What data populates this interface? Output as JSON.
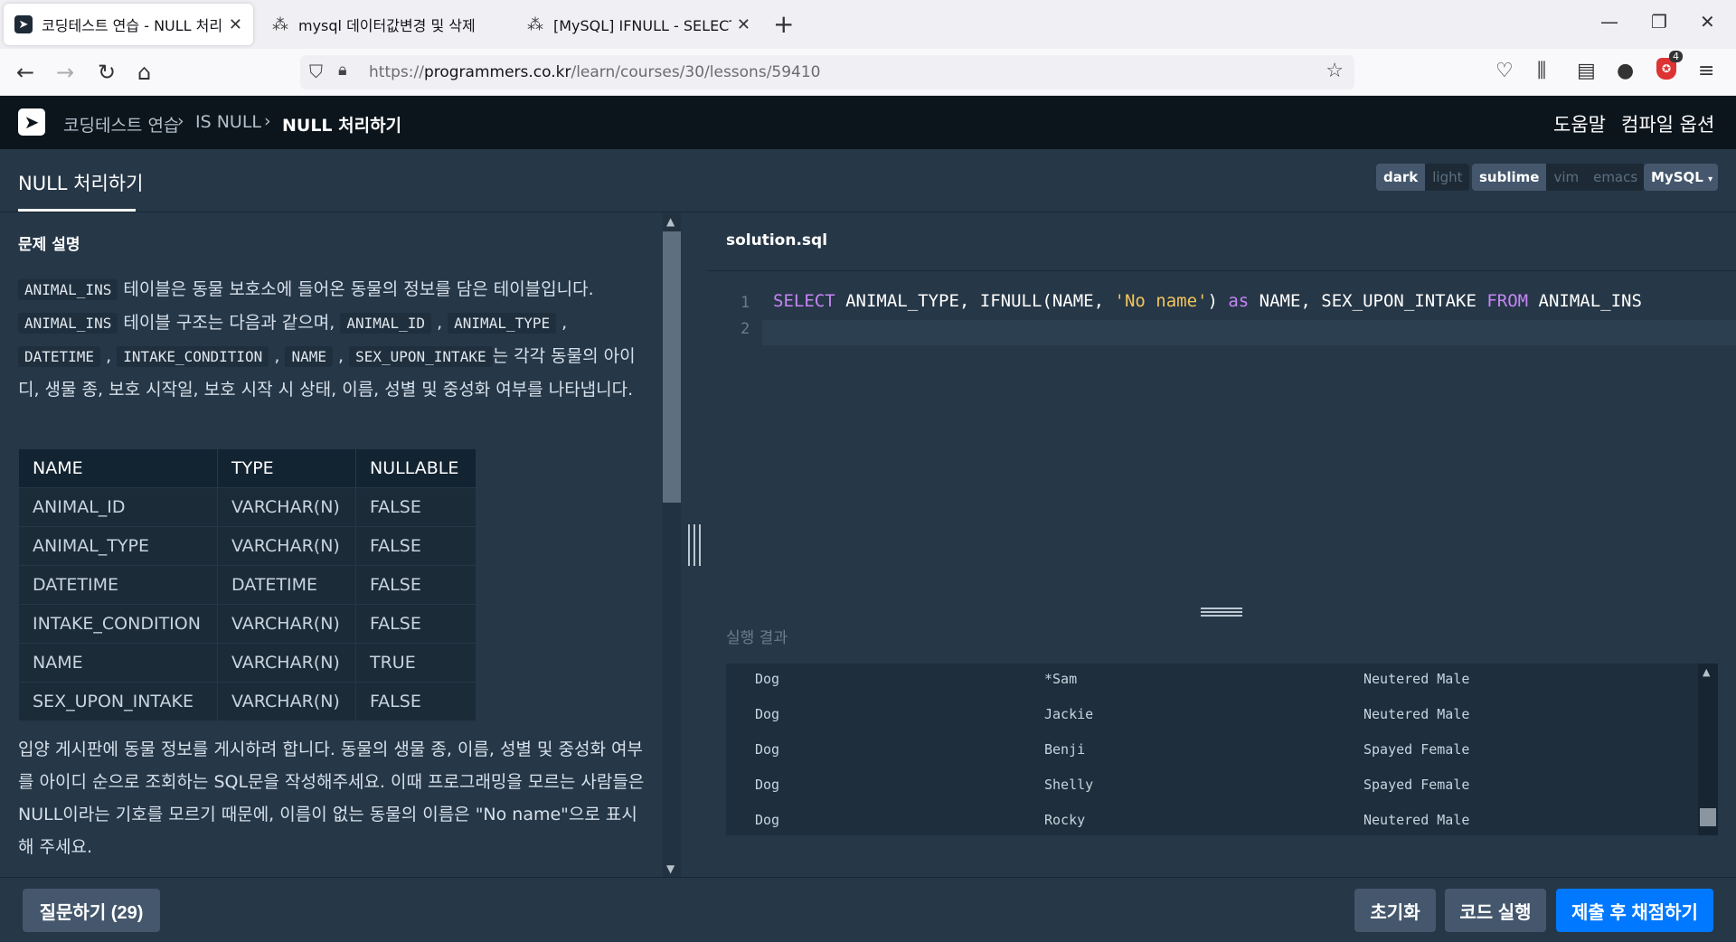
{
  "browser": {
    "tabs": [
      {
        "title": "코딩테스트 연습 - NULL 처리하",
        "active": true
      },
      {
        "title": "mysql 데이터값변경 및 삭제",
        "active": false
      },
      {
        "title": "[MySQL] IFNULL - SELECT 문에",
        "active": false
      }
    ],
    "url_prefix": "https://",
    "url_domain": "programmers.co.kr",
    "url_path": "/learn/courses/30/lessons/59410",
    "extension_badge": "4"
  },
  "header": {
    "breadcrumb": [
      "코딩테스트 연습",
      "IS NULL",
      "NULL 처리하기"
    ],
    "help": "도움말",
    "compile_options": "컴파일 옵션"
  },
  "subheader": {
    "lesson_title": "NULL 처리하기",
    "themes": [
      "dark",
      "light"
    ],
    "keymaps": [
      "sublime",
      "vim",
      "emacs"
    ],
    "language": "MySQL"
  },
  "problem": {
    "section_title": "문제 설명",
    "intro": {
      "table_name": "ANIMAL_INS",
      "text1": " 테이블은 동물 보호소에 들어온 동물의 정보를 담은 테이블입니다. ",
      "text2": " 테이블 구조는 다음과 같으며, ",
      "cols": [
        "ANIMAL_ID",
        "ANIMAL_TYPE",
        "DATETIME",
        "INTAKE_CONDITION",
        "NAME",
        "SEX_UPON_INTAKE"
      ],
      "text3": "는 각각 동물의 아이디, 생물 종, 보호 시작일, 보호 시작 시 상태, 이름, 성별 및 중성화 여부를 나타냅니다."
    },
    "schema": {
      "headers": [
        "NAME",
        "TYPE",
        "NULLABLE"
      ],
      "rows": [
        [
          "ANIMAL_ID",
          "VARCHAR(N)",
          "FALSE"
        ],
        [
          "ANIMAL_TYPE",
          "VARCHAR(N)",
          "FALSE"
        ],
        [
          "DATETIME",
          "DATETIME",
          "FALSE"
        ],
        [
          "INTAKE_CONDITION",
          "VARCHAR(N)",
          "FALSE"
        ],
        [
          "NAME",
          "VARCHAR(N)",
          "TRUE"
        ],
        [
          "SEX_UPON_INTAKE",
          "VARCHAR(N)",
          "FALSE"
        ]
      ]
    },
    "task": "입양 게시판에 동물 정보를 게시하려 합니다. 동물의 생물 종, 이름, 성별 및 중성화 여부를 아이디 순으로 조회하는 SQL문을 작성해주세요. 이때 프로그래밍을 모르는 사람들은 NULL이라는 기호를 모르기 때문에, 이름이 없는 동물의 이름은 \"No name\"으로 표시해 주세요."
  },
  "editor": {
    "filename": "solution.sql",
    "line_numbers": [
      "1",
      "2"
    ],
    "code": {
      "kw1": "SELECT",
      "part1": " ANIMAL_TYPE, IFNULL(NAME, ",
      "str": "'No name'",
      "part2": ") ",
      "kw2": "as",
      "part3": " NAME, SEX_UPON_INTAKE ",
      "kw3": "FROM",
      "part4": " ANIMAL_INS"
    }
  },
  "results": {
    "title": "실행 결과",
    "rows": [
      [
        "Dog",
        "*Sam",
        "Neutered Male"
      ],
      [
        "Dog",
        "Jackie",
        "Neutered Male"
      ],
      [
        "Dog",
        "Benji",
        "Spayed Female"
      ],
      [
        "Dog",
        "Shelly",
        "Spayed Female"
      ],
      [
        "Dog",
        "Rocky",
        "Neutered Male"
      ]
    ]
  },
  "footer": {
    "ask": "질문하기 (29)",
    "reset": "초기화",
    "run": "코드 실행",
    "submit": "제출 후 채점하기"
  },
  "colors": {
    "panel": "#263747",
    "header": "#0c151c",
    "primary": "#0078ff",
    "keyword": "#c586f5",
    "string": "#f3c55b"
  }
}
